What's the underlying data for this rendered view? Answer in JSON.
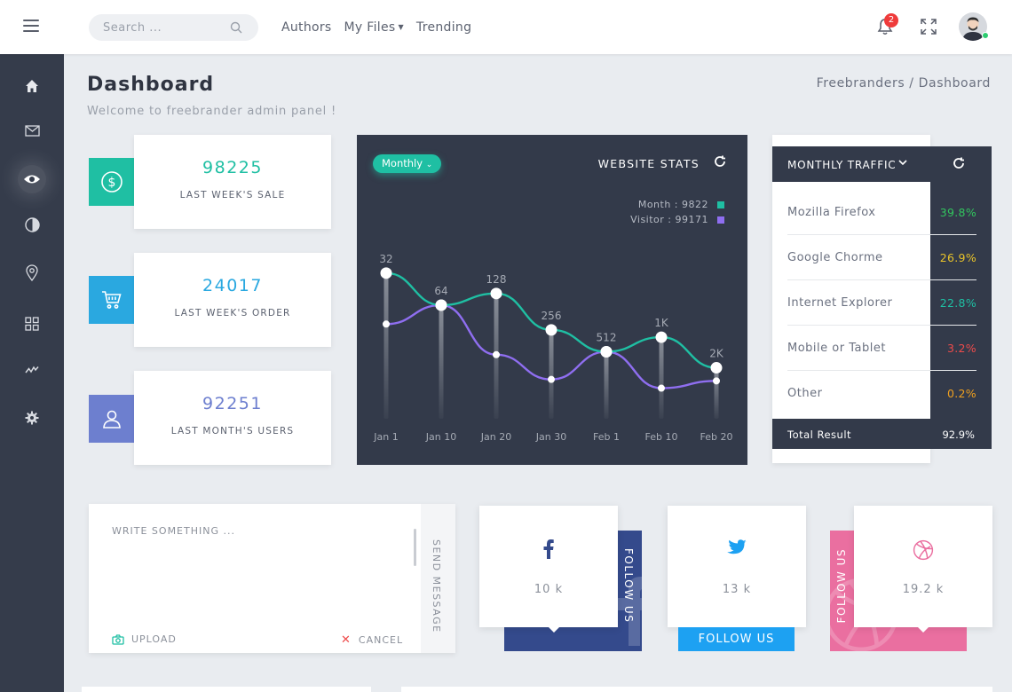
{
  "topbar": {
    "search_placeholder": "Search ...",
    "nav": {
      "authors": "Authors",
      "my_files": "My Files",
      "trending": "Trending"
    },
    "notification_count": "2"
  },
  "sidebar": {
    "items": [
      {
        "icon": "home-icon"
      },
      {
        "icon": "mail-icon"
      },
      {
        "icon": "eye-icon",
        "active": true
      },
      {
        "icon": "contrast-icon"
      },
      {
        "icon": "location-pin-icon"
      },
      {
        "icon": "grid-icon"
      },
      {
        "icon": "activity-icon"
      },
      {
        "icon": "gear-icon"
      }
    ]
  },
  "header": {
    "title": "Dashboard",
    "subtitle": "Welcome to freebrander admin panel !",
    "breadcrumb": "Freebranders / Dashboard"
  },
  "stats": [
    {
      "value": "98225",
      "label": "LAST WEEK'S SALE",
      "color": "#1fbfa3",
      "icon": "dollar-icon"
    },
    {
      "value": "24017",
      "label": "LAST WEEK'S ORDER",
      "color": "#2aa8e0",
      "icon": "cart-icon"
    },
    {
      "value": "92251",
      "label": "LAST MONTH'S USERS",
      "color": "#6d7fcf",
      "icon": "user-icon"
    }
  ],
  "website_stats": {
    "title": "WEBSITE STATS",
    "period": "Monthly",
    "legend": [
      {
        "text": "Month : 9822",
        "color": "#1fbfa3"
      },
      {
        "text": "Visitor : 99171",
        "color": "#8f6ef0"
      }
    ]
  },
  "chart_data": {
    "type": "line",
    "categories": [
      "Jan 1",
      "Jan 10",
      "Jan 20",
      "Jan 30",
      "Feb 1",
      "Feb 10",
      "Feb 20"
    ],
    "point_labels": [
      "32",
      "64",
      "128",
      "256",
      "512",
      "1K",
      "2K"
    ],
    "series": [
      {
        "color": "#1fbfa3",
        "values": [
          10.0,
          7.8,
          8.6,
          6.1,
          4.6,
          5.6,
          3.5
        ]
      },
      {
        "color": "#8f6ef0",
        "values": [
          6.5,
          7.8,
          4.4,
          2.7,
          4.6,
          2.1,
          2.6
        ]
      }
    ],
    "ylim": [
      0,
      12
    ],
    "grid": false
  },
  "traffic": {
    "title": "MONTHLY TRAFFIC",
    "rows": [
      {
        "name": "Mozilla Firefox",
        "value": "39.8%",
        "color": "#32c45e"
      },
      {
        "name": "Google Chorme",
        "value": "26.9%",
        "color": "#e8c32a"
      },
      {
        "name": "Internet Explorer",
        "value": "22.8%",
        "color": "#1fbfa3"
      },
      {
        "name": "Mobile or Tablet",
        "value": "3.2%",
        "color": "#ee4b4b"
      },
      {
        "name": "Other",
        "value": "0.2%",
        "color": "#f0a020"
      }
    ],
    "total_label": "Total Result",
    "total_value": "92.9%"
  },
  "message": {
    "placeholder": "WRITE SOMETHING ...",
    "send": "SEND MESSAGE",
    "upload": "UPLOAD",
    "cancel": "CANCEL"
  },
  "social": [
    {
      "network": "facebook-icon",
      "count": "10 k",
      "follow": "FOLLOW US",
      "color": "#344a8c"
    },
    {
      "network": "twitter-icon",
      "count": "13 k",
      "follow": "FOLLOW US",
      "color": "#1da1f2"
    },
    {
      "network": "dribbble-icon",
      "count": "19.2 k",
      "follow": "FOLLOW US",
      "color": "#ea6fa0"
    }
  ]
}
